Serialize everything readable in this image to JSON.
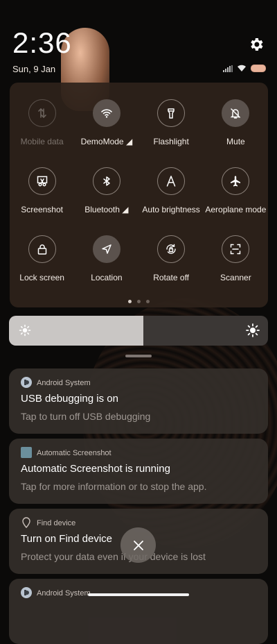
{
  "status": {
    "time": "2:36",
    "date": "Sun, 9 Jan"
  },
  "toggles": [
    {
      "label": "Mobile data",
      "icon": "mobile-data-icon",
      "state": "disabled"
    },
    {
      "label": "DemoMode ◢",
      "icon": "wifi-icon",
      "state": "on"
    },
    {
      "label": "Flashlight",
      "icon": "flashlight-icon",
      "state": "off"
    },
    {
      "label": "Mute",
      "icon": "mute-bell-icon",
      "state": "on"
    },
    {
      "label": "Screenshot",
      "icon": "screenshot-icon",
      "state": "off"
    },
    {
      "label": "Bluetooth ◢",
      "icon": "bluetooth-icon",
      "state": "off"
    },
    {
      "label": "Auto brightness",
      "icon": "auto-brightness-icon",
      "state": "off"
    },
    {
      "label": "Aeroplane mode",
      "icon": "airplane-icon",
      "state": "off"
    },
    {
      "label": "Lock screen",
      "icon": "lock-icon",
      "state": "off"
    },
    {
      "label": "Location",
      "icon": "location-icon",
      "state": "on"
    },
    {
      "label": "Rotate off",
      "icon": "rotate-lock-icon",
      "state": "off"
    },
    {
      "label": "Scanner",
      "icon": "scanner-icon",
      "state": "off"
    }
  ],
  "page_indicator": {
    "count": 3,
    "active": 0
  },
  "brightness": {
    "level": 0.52
  },
  "notifications": [
    {
      "app": "Android System",
      "title": "USB debugging is on",
      "text": "Tap to turn off USB debugging",
      "icon": "android-system-icon"
    },
    {
      "app": "Automatic Screenshot",
      "title": "Automatic Screenshot is running",
      "text": "Tap for more information or to stop the app.",
      "icon": "app-square-icon"
    },
    {
      "app": "Find device",
      "title": "Turn on Find device",
      "text": "Protect your data even if your device is lost",
      "icon": "location-pin-icon"
    },
    {
      "app": "Android System",
      "title": "",
      "text": "",
      "icon": "android-system-icon"
    }
  ],
  "colors": {
    "panel": "#2e221b",
    "accent_on": "#5b524d",
    "battery": "#e9b39a"
  }
}
